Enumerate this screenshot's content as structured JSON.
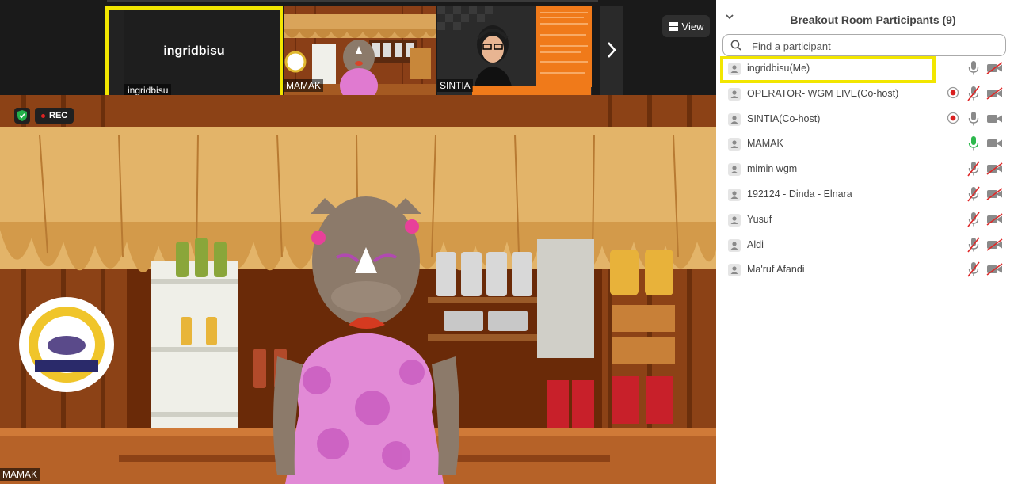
{
  "self_tile": {
    "display_name": "ingridbisu",
    "label": "ingridbisu"
  },
  "thumbnails": [
    {
      "label": "MAMAK"
    },
    {
      "label": "SINTIA"
    }
  ],
  "view_button": {
    "label": "View"
  },
  "main_video": {
    "label": "MAMAK",
    "rec_label": "REC"
  },
  "panel": {
    "title": "Breakout Room Participants (9)",
    "search_placeholder": "Find a participant",
    "participants": [
      {
        "name": "ingridbisu(Me)",
        "recording": false,
        "mic": "on",
        "video": "off",
        "highlighted": true
      },
      {
        "name": "OPERATOR- WGM LIVE(Co-host)",
        "recording": true,
        "mic": "off",
        "video": "off"
      },
      {
        "name": "SINTIA(Co-host)",
        "recording": true,
        "mic": "on",
        "video": "on"
      },
      {
        "name": "MAMAK",
        "recording": false,
        "mic": "active",
        "video": "on"
      },
      {
        "name": "mimin wgm",
        "recording": false,
        "mic": "off",
        "video": "off"
      },
      {
        "name": "192124 - Dinda - Elnara",
        "recording": false,
        "mic": "off",
        "video": "off"
      },
      {
        "name": "Yusuf",
        "recording": false,
        "mic": "off",
        "video": "off"
      },
      {
        "name": "Aldi",
        "recording": false,
        "mic": "off",
        "video": "off"
      },
      {
        "name": "Ma'ruf Afandi",
        "recording": false,
        "mic": "off",
        "video": "off"
      }
    ]
  },
  "colors": {
    "highlight": "#f2e600",
    "mic_active": "#2db84d",
    "muted_red": "#e02828",
    "record_red": "#d92020"
  }
}
